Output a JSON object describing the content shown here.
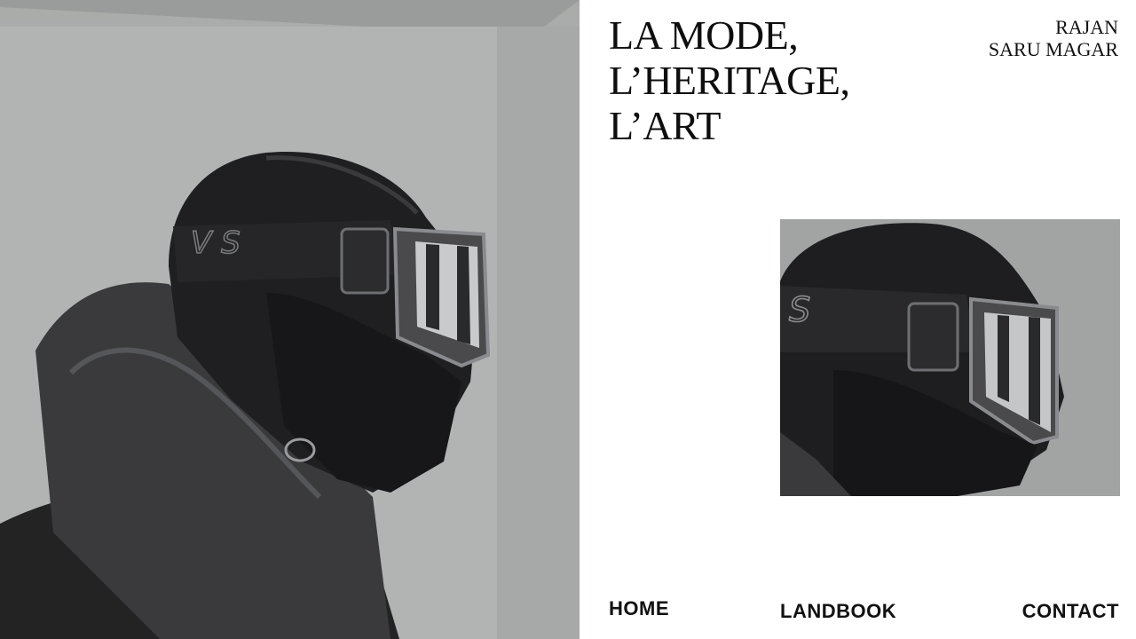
{
  "header": {
    "title_lines": [
      "LA MODE,",
      "L’HERITAGE,",
      "L’ART"
    ],
    "author_lines": [
      "RAJAN",
      "SARU MAGAR"
    ]
  },
  "nav": {
    "home": "HOME",
    "landbook": "LANDBOOK",
    "contact": "CONTACT"
  },
  "images": {
    "hero": "person-in-hood-and-ski-goggles-photo",
    "thumbnail": "person-in-hood-and-ski-goggles-closeup-photo"
  },
  "colors": {
    "background": "#ffffff",
    "text": "#111111",
    "photo_wall": "#b0b2b1",
    "jacket": "#2b2b2c"
  }
}
